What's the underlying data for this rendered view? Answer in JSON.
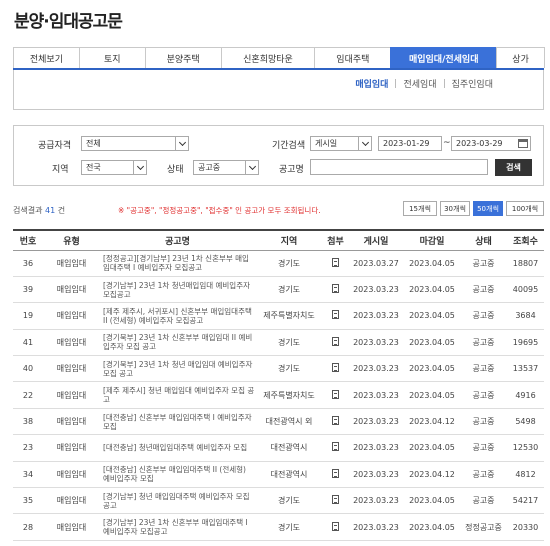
{
  "page": {
    "title": "분양·임대공고문"
  },
  "tabs": [
    {
      "label": "전체보기",
      "active": false
    },
    {
      "label": "토지",
      "active": false
    },
    {
      "label": "분양주택",
      "active": false
    },
    {
      "label": "신혼희망타운",
      "active": false
    },
    {
      "label": "임대주택",
      "active": false
    },
    {
      "label": "매입임대/전세임대",
      "active": true
    },
    {
      "label": "상가",
      "active": false
    }
  ],
  "subtabs": [
    {
      "label": "매입임대",
      "active": true
    },
    {
      "label": "전세임대",
      "active": false
    },
    {
      "label": "집주인임대",
      "active": false
    }
  ],
  "filter": {
    "qualification_label": "공급자격",
    "qualification_value": "전체",
    "period_label": "기간검색",
    "period_type_value": "게시일",
    "date_from": "2023-01-29",
    "date_sep": "~",
    "date_to": "2023-03-29",
    "region_label": "지역",
    "region_value": "전국",
    "status_label": "상태",
    "status_value": "공고중",
    "name_label": "공고명",
    "name_value": "",
    "search_button": "검색"
  },
  "results": {
    "prefix": "검색결과",
    "count": "41",
    "suffix": "건",
    "notice": "※ \"공고중\", \"정정공고중\", \"접수중\" 인 공고가 모두 조회됩니다.",
    "page_sizes": [
      {
        "label": "15개씩",
        "active": false
      },
      {
        "label": "30개씩",
        "active": false
      },
      {
        "label": "50개씩",
        "active": true
      },
      {
        "label": "100개씩",
        "active": false
      }
    ]
  },
  "table": {
    "headers": [
      "번호",
      "유형",
      "공고명",
      "지역",
      "첨부",
      "게시일",
      "마감일",
      "상태",
      "조회수"
    ],
    "rows": [
      {
        "no": "36",
        "type": "매입임대",
        "name": "[정정공고][경기남부] 23년 1차 신혼부부 매입임대주택 I 예비입주자 모집공고",
        "region": "경기도",
        "posted": "2023.03.27",
        "deadline": "2023.04.05",
        "status": "공고중",
        "views": "18807"
      },
      {
        "no": "39",
        "type": "매입임대",
        "name": "[경기남부] 23년 1차 청년매입임대 예비입주자 모집공고",
        "region": "경기도",
        "posted": "2023.03.23",
        "deadline": "2023.04.05",
        "status": "공고중",
        "views": "40095"
      },
      {
        "no": "19",
        "type": "매입임대",
        "name": "[제주 제주시, 서귀포시] 신혼부부 매입임대주택 II (전세형) 예비입주자 모집공고",
        "region": "제주특별자치도",
        "posted": "2023.03.23",
        "deadline": "2023.04.05",
        "status": "공고중",
        "views": "3684"
      },
      {
        "no": "41",
        "type": "매입임대",
        "name": "[경기북부] 23년 1차 신혼부부 매입임대 II 예비입주자 모집 공고",
        "region": "경기도",
        "posted": "2023.03.23",
        "deadline": "2023.04.05",
        "status": "공고중",
        "views": "19695"
      },
      {
        "no": "40",
        "type": "매입임대",
        "name": "[경기북부] 23년 1차 청년 매입임대 예비입주자 모집 공고",
        "region": "경기도",
        "posted": "2023.03.23",
        "deadline": "2023.04.05",
        "status": "공고중",
        "views": "13537"
      },
      {
        "no": "22",
        "type": "매입임대",
        "name": "[제주 제주시] 청년 매입임대 예비입주자 모집 공고",
        "region": "제주특별자치도",
        "posted": "2023.03.23",
        "deadline": "2023.04.05",
        "status": "공고중",
        "views": "4916"
      },
      {
        "no": "38",
        "type": "매입임대",
        "name": "[대전충남] 신혼부부 매입임대주택 I 예비입주자 모집",
        "region": "대전광역시 외",
        "posted": "2023.03.23",
        "deadline": "2023.04.12",
        "status": "공고중",
        "views": "5498"
      },
      {
        "no": "23",
        "type": "매입임대",
        "name": "[대전충남] 청년매입임대주택 예비입주자 모집",
        "region": "대전광역시",
        "posted": "2023.03.23",
        "deadline": "2023.04.05",
        "status": "공고중",
        "views": "12530"
      },
      {
        "no": "34",
        "type": "매입임대",
        "name": "[대전충남] 신혼부부 매입임대주택 II (전세형) 예비입주자 모집",
        "region": "대전광역시",
        "posted": "2023.03.23",
        "deadline": "2023.04.12",
        "status": "공고중",
        "views": "4812"
      },
      {
        "no": "35",
        "type": "매입임대",
        "name": "[경기남부] 청년 매입임대주택 예비입주자 모집공고",
        "region": "경기도",
        "posted": "2023.03.23",
        "deadline": "2023.04.05",
        "status": "공고중",
        "views": "54217"
      },
      {
        "no": "28",
        "type": "매입임대",
        "name": "[경기남부] 23년 1차 신혼부부 매입임대주택 I 예비입주자 모집공고",
        "region": "경기도",
        "posted": "2023.03.23",
        "deadline": "2023.04.05",
        "status": "정정공고중",
        "views": "20330"
      }
    ]
  }
}
